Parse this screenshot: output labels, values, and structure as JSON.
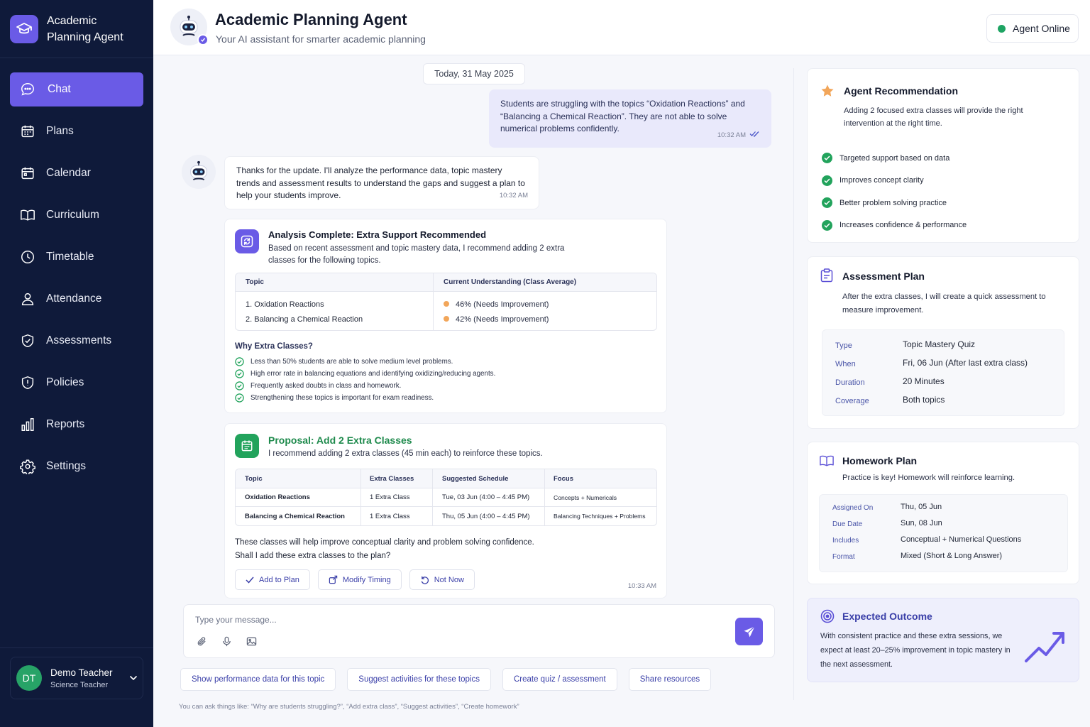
{
  "app": {
    "name": "Academic Planning Agent"
  },
  "sidebar": {
    "items": [
      {
        "label": "Chat",
        "icon": "chat-icon"
      },
      {
        "label": "Plans",
        "icon": "plans-icon"
      },
      {
        "label": "Calendar",
        "icon": "calendar-icon"
      },
      {
        "label": "Curriculum",
        "icon": "book-icon"
      },
      {
        "label": "Timetable",
        "icon": "clock-icon"
      },
      {
        "label": "Attendance",
        "icon": "user-icon"
      },
      {
        "label": "Assessments",
        "icon": "shield-check-icon"
      },
      {
        "label": "Policies",
        "icon": "shield-info-icon"
      },
      {
        "label": "Reports",
        "icon": "bar-chart-icon"
      },
      {
        "label": "Settings",
        "icon": "gear-icon"
      }
    ],
    "active": "Chat",
    "user": {
      "initials": "DT",
      "name": "Demo Teacher",
      "role": "Science Teacher"
    }
  },
  "header": {
    "title": "Academic Planning Agent",
    "subtitle": "Your AI assistant for smarter academic planning",
    "status": "Agent Online"
  },
  "chat": {
    "date": "Today, 31 May 2025",
    "user_message": {
      "text": "Students are struggling with the topics “Oxidation Reactions” and “Balancing a Chemical Reaction”. They are not able to solve numerical problems confidently.",
      "time": "10:32 AM"
    },
    "bot_message": {
      "text": "Thanks for the update. I'll analyze the performance data, topic mastery trends and assessment results to understand the gaps and suggest a plan to help your students improve.",
      "time": "10:32 AM"
    },
    "analysis": {
      "title": "Analysis Complete: Extra Support Recommended",
      "desc": "Based on recent assessment and topic mastery data, I recommend adding 2 extra classes for the following topics.",
      "table_headers": [
        "Topic",
        "Current Understanding (Class Average)"
      ],
      "rows": [
        {
          "topic": "1. Oxidation Reactions",
          "pct": "46%",
          "note": "(Needs Improvement)"
        },
        {
          "topic": "2. Balancing a Chemical Reaction",
          "pct": "42%",
          "note": "(Needs Improvement)"
        }
      ],
      "why_title": "Why Extra Classes?",
      "why": [
        "Less than 50% students are able to solve medium level problems.",
        "High error rate in balancing equations and identifying oxidizing/reducing agents.",
        "Frequently asked doubts in class and homework.",
        "Strengthening these topics is important for exam readiness."
      ]
    },
    "proposal": {
      "title": "Proposal: Add 2 Extra Classes",
      "desc": "I recommend adding 2 extra classes (45 min each) to reinforce these topics.",
      "headers": [
        "Topic",
        "Extra Classes",
        "Suggested Schedule",
        "Focus"
      ],
      "rows": [
        [
          "Oxidation Reactions",
          "1 Extra Class",
          "Tue, 03 Jun (4:00 – 4:45 PM)",
          "Concepts + Numericals"
        ],
        [
          "Balancing a Chemical Reaction",
          "1 Extra Class",
          "Thu, 05 Jun (4:00 – 4:45 PM)",
          "Balancing Techniques + Problems"
        ]
      ],
      "text1": "These classes will help improve conceptual clarity and problem solving confidence.",
      "text2": "Shall I add these extra classes to the plan?",
      "actions": [
        "Add to Plan",
        "Modify Timing",
        "Not Now"
      ],
      "time": "10:33 AM"
    },
    "composer": {
      "placeholder": "Type your message..."
    },
    "suggestions": [
      "Show performance data for this topic",
      "Suggest activities for these topics",
      "Create quiz / assessment",
      "Share resources"
    ],
    "hint": "You can ask things like: “Why are students struggling?”, “Add extra class”, “Suggest activities”, “Create homework”"
  },
  "right": {
    "recommendation": {
      "title": "Agent Recommendation",
      "desc": "Adding 2 focused extra classes will provide the right intervention at the right time.",
      "points": [
        "Targeted support based on data",
        "Improves concept clarity",
        "Better problem solving practice",
        "Increases confidence & performance"
      ]
    },
    "assessment": {
      "title": "Assessment Plan",
      "desc": "After the extra classes, I will create a quick assessment to measure improvement.",
      "rows": [
        {
          "k": "Type",
          "v": "Topic Mastery Quiz"
        },
        {
          "k": "When",
          "v": "Fri, 06 Jun (After last extra class)"
        },
        {
          "k": "Duration",
          "v": "20 Minutes"
        },
        {
          "k": "Coverage",
          "v": "Both topics"
        }
      ]
    },
    "homework": {
      "title": "Homework Plan",
      "desc": "Practice is key! Homework will reinforce learning.",
      "rows": [
        {
          "k": "Assigned On",
          "v": "Thu, 05 Jun"
        },
        {
          "k": "Due Date",
          "v": "Sun, 08 Jun"
        },
        {
          "k": "Includes",
          "v": "Conceptual + Numerical Questions"
        },
        {
          "k": "Format",
          "v": "Mixed (Short & Long Answer)"
        }
      ]
    },
    "outcome": {
      "title": "Expected Outcome",
      "desc": "With consistent practice and these extra sessions, we expect at least 20–25% improvement in topic mastery in the next assessment."
    }
  },
  "colors": {
    "accent": "#6a5be6",
    "sidebar": "#0f1a3a",
    "success": "#22a35c",
    "warning": "#f2a65a"
  }
}
